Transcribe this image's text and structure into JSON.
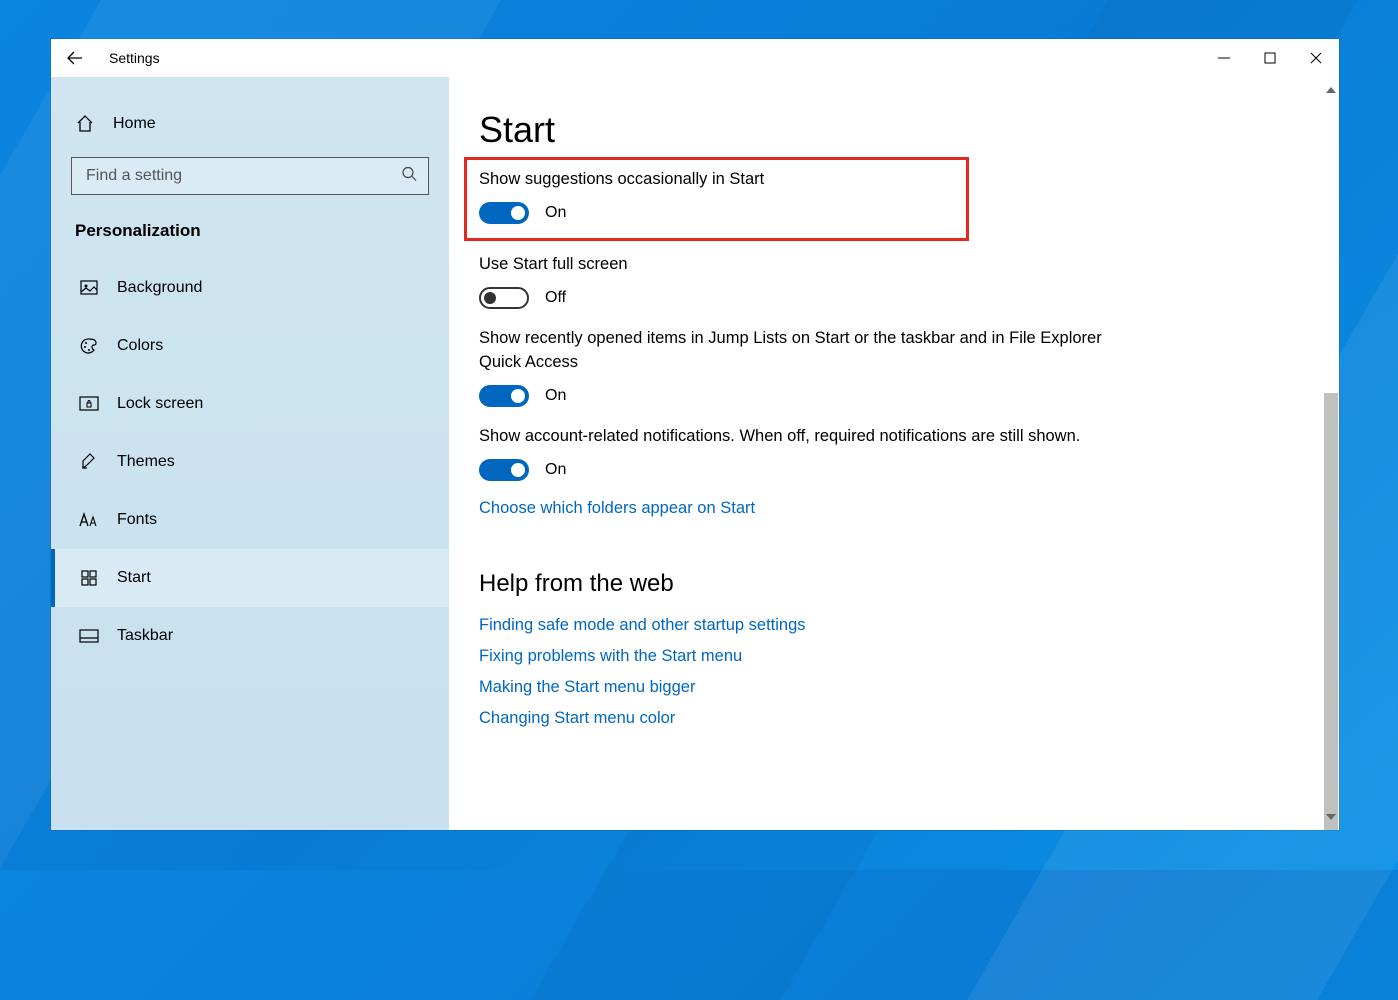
{
  "window": {
    "title": "Settings"
  },
  "sidebar": {
    "home_label": "Home",
    "search_placeholder": "Find a setting",
    "section_title": "Personalization",
    "items": [
      {
        "label": "Background"
      },
      {
        "label": "Colors"
      },
      {
        "label": "Lock screen"
      },
      {
        "label": "Themes"
      },
      {
        "label": "Fonts"
      },
      {
        "label": "Start"
      },
      {
        "label": "Taskbar"
      }
    ],
    "active_index": 5
  },
  "page": {
    "heading": "Start",
    "settings": [
      {
        "label": "Show suggestions occasionally in Start",
        "state": "On",
        "on": true,
        "highlighted": true
      },
      {
        "label": "Use Start full screen",
        "state": "Off",
        "on": false
      },
      {
        "label": "Show recently opened items in Jump Lists on Start or the taskbar and in File Explorer Quick Access",
        "state": "On",
        "on": true
      },
      {
        "label": "Show account-related notifications. When off, required notifications are still shown.",
        "state": "On",
        "on": true
      }
    ],
    "folders_link": "Choose which folders appear on Start",
    "help_heading": "Help from the web",
    "help_links": [
      "Finding safe mode and other startup settings",
      "Fixing problems with the Start menu",
      "Making the Start menu bigger",
      "Changing Start menu color"
    ]
  }
}
